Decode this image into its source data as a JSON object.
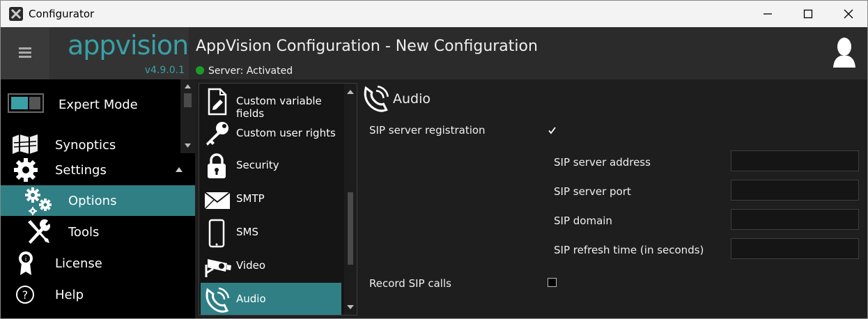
{
  "window": {
    "title": "Configurator"
  },
  "header": {
    "logo": "appvision",
    "version": "v4.9.0.1",
    "title": "AppVision Configuration - New Configuration",
    "status": "Server: Activated",
    "status_color": "#1c9a2a",
    "accent": "#3aa0a6"
  },
  "nav": {
    "expert_mode": "Expert Mode",
    "items": [
      {
        "label": "Synoptics",
        "icon": "map-icon"
      },
      {
        "label": "Settings",
        "icon": "gear-icon"
      },
      {
        "label": "Options",
        "icon": "gears-icon",
        "selected": true
      },
      {
        "label": "Tools",
        "icon": "tools-icon"
      },
      {
        "label": "License",
        "icon": "license-icon"
      },
      {
        "label": "Help",
        "icon": "help-icon"
      }
    ]
  },
  "list": {
    "items": [
      {
        "label": "Custom variable fields",
        "icon": "document-pen-icon"
      },
      {
        "label": "Custom user rights",
        "icon": "key-icon"
      },
      {
        "label": "Security",
        "icon": "lock-icon"
      },
      {
        "label": "SMTP",
        "icon": "envelope-icon"
      },
      {
        "label": "SMS",
        "icon": "phone-icon"
      },
      {
        "label": "Video",
        "icon": "camera-icon"
      },
      {
        "label": "Audio",
        "icon": "audio-phone-icon",
        "selected": true
      }
    ]
  },
  "panel": {
    "title": "Audio",
    "sip_registration": {
      "label": "SIP server registration",
      "checked": true
    },
    "fields": [
      {
        "label": "SIP server address",
        "value": ""
      },
      {
        "label": "SIP server port",
        "value": ""
      },
      {
        "label": "SIP domain",
        "value": ""
      },
      {
        "label": "SIP refresh time (in seconds)",
        "value": ""
      }
    ],
    "record_calls": {
      "label": "Record SIP calls",
      "checked": false
    }
  }
}
